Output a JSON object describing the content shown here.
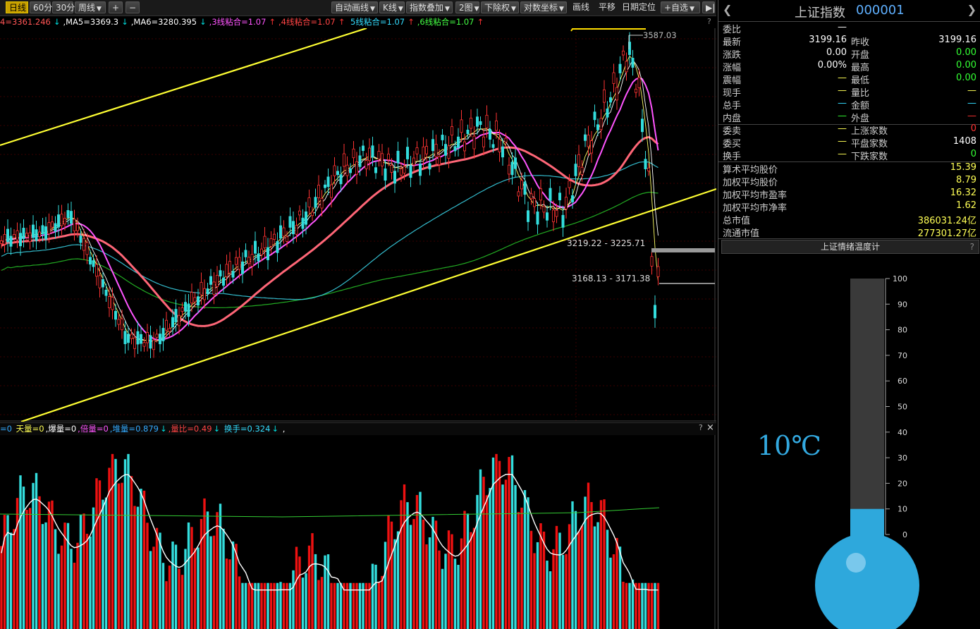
{
  "toolbar": {
    "items": [
      {
        "label": "日线",
        "active": true,
        "dd": false
      },
      {
        "label": "60分",
        "active": false,
        "dd": false
      },
      {
        "label": "30分",
        "active": false,
        "dd": false
      },
      {
        "label": "周线",
        "active": false,
        "dd": true
      },
      {
        "label": "+",
        "active": false,
        "dd": false
      },
      {
        "label": "−",
        "active": false,
        "dd": false
      },
      {
        "label": "自动画线",
        "active": false,
        "dd": true
      },
      {
        "label": "K线",
        "active": false,
        "dd": true
      },
      {
        "label": "指数叠加",
        "active": false,
        "dd": true
      },
      {
        "label": "2图",
        "active": false,
        "dd": true
      },
      {
        "label": "下除权",
        "active": false,
        "dd": true
      },
      {
        "label": "对数坐标",
        "active": false,
        "dd": true
      },
      {
        "label": "画线",
        "active": false,
        "dd": false
      },
      {
        "label": "平移",
        "active": false,
        "dd": false
      },
      {
        "label": "日期定位",
        "active": false,
        "dd": false
      },
      {
        "label": "+自选",
        "active": false,
        "dd": true
      },
      {
        "label": "▶|",
        "active": false,
        "dd": false
      }
    ]
  },
  "ma_legend": [
    {
      "text": "4=3361.246",
      "color": "#ff5555",
      "arrow": "↓",
      "arrow_color": "#00dddd"
    },
    {
      "text": ",MA5=3369.3",
      "color": "#ffffff",
      "arrow": "↓",
      "arrow_color": "#00dddd"
    },
    {
      "text": ",MA6=3280.395",
      "color": "#ffffff",
      "arrow": "↓",
      "arrow_color": "#00dddd"
    },
    {
      "text": ",3线粘合=1.07",
      "color": "#ff55ff",
      "arrow": "↑",
      "arrow_color": "#ff3333"
    },
    {
      "text": ",4线粘合=1.07",
      "color": "#ff4444",
      "arrow": "↑",
      "arrow_color": "#ff3333"
    },
    {
      "text": " 5线粘合=1.07",
      "color": "#33ddff",
      "arrow": "↑",
      "arrow_color": "#ff3333"
    },
    {
      "text": ",6线粘合=1.07",
      "color": "#44ff44",
      "arrow": "↑",
      "arrow_color": "#ff3333"
    }
  ],
  "price_labels": {
    "high": "3587.03",
    "range1": "3219.22 - 3225.71",
    "range2": "3168.13 - 3171.38"
  },
  "vol_legend": [
    {
      "text": "=0",
      "color": "#33aaff"
    },
    {
      "text": " 天量=0",
      "color": "#ffff55"
    },
    {
      "text": ",爆量=0",
      "color": "#ffffff"
    },
    {
      "text": ",倍量=0",
      "color": "#ff55ff"
    },
    {
      "text": ",堆量=0.879",
      "color": "#33aaff",
      "arrow": "↓",
      "arrow_color": "#00dddd"
    },
    {
      "text": ",量比=0.49",
      "color": "#ff4444",
      "arrow": "↓",
      "arrow_color": "#00dddd"
    },
    {
      "text": "  换手=0.324",
      "color": "#33ddff",
      "arrow": "↓",
      "arrow_color": "#00dddd"
    },
    {
      "text": " ,",
      "color": "#ffffff"
    }
  ],
  "quote": {
    "name": "上证指数",
    "code": "000001",
    "rows": [
      {
        "k1": "委比",
        "v1": "—",
        "c1": "#ffffff",
        "k2": "",
        "v2": "",
        "c2": "#ffffff"
      },
      {
        "k1": "最新",
        "v1": "3199.16",
        "c1": "#ffffff",
        "k2": "昨收",
        "v2": "3199.16",
        "c2": "#ffffff"
      },
      {
        "k1": "涨跌",
        "v1": "0.00",
        "c1": "#ffffff",
        "k2": "开盘",
        "v2": "0.00",
        "c2": "#33ff33"
      },
      {
        "k1": "涨幅",
        "v1": "0.00%",
        "c1": "#ffffff",
        "k2": "最高",
        "v2": "0.00",
        "c2": "#33ff33"
      },
      {
        "k1": "震幅",
        "v1": "—",
        "c1": "#ffff55",
        "k2": "最低",
        "v2": "0.00",
        "c2": "#33ff33"
      },
      {
        "k1": "现手",
        "v1": "—",
        "c1": "#ffff55",
        "k2": "量比",
        "v2": "—",
        "c2": "#ffff55"
      },
      {
        "k1": "总手",
        "v1": "—",
        "c1": "#33ddff",
        "k2": "金额",
        "v2": "—",
        "c2": "#33ddff"
      },
      {
        "k1": "内盘",
        "v1": "—",
        "c1": "#33ff33",
        "k2": "外盘",
        "v2": "—",
        "c2": "#ff3333"
      },
      {
        "k1": "委卖",
        "v1": "—",
        "c1": "#ffff55",
        "k2": "上涨家数",
        "v2": "0",
        "c2": "#ff3333"
      },
      {
        "k1": "委买",
        "v1": "—",
        "c1": "#ffff55",
        "k2": "平盘家数",
        "v2": "1408",
        "c2": "#ffffff"
      },
      {
        "k1": "换手",
        "v1": "—",
        "c1": "#ffff55",
        "k2": "下跌家数",
        "v2": "0",
        "c2": "#33ff33"
      }
    ],
    "wide_rows": [
      {
        "k": "算术平均股价",
        "v": "15.39"
      },
      {
        "k": "加权平均股价",
        "v": "8.79"
      },
      {
        "k": "加权平均市盈率",
        "v": "16.32"
      },
      {
        "k": "加权平均市净率",
        "v": "1.62"
      },
      {
        "k": "总市值",
        "v": "386031.24亿"
      },
      {
        "k": "流通市值",
        "v": "277301.27亿"
      }
    ]
  },
  "gauge": {
    "title": "上证情绪温度计",
    "help": "?",
    "temperature_text": "10℃",
    "level": 10,
    "ticks": [
      "100",
      "90",
      "80",
      "70",
      "60",
      "50",
      "40",
      "30",
      "20",
      "10",
      "0"
    ]
  },
  "misc": {
    "help": "?",
    "close": "×"
  }
}
